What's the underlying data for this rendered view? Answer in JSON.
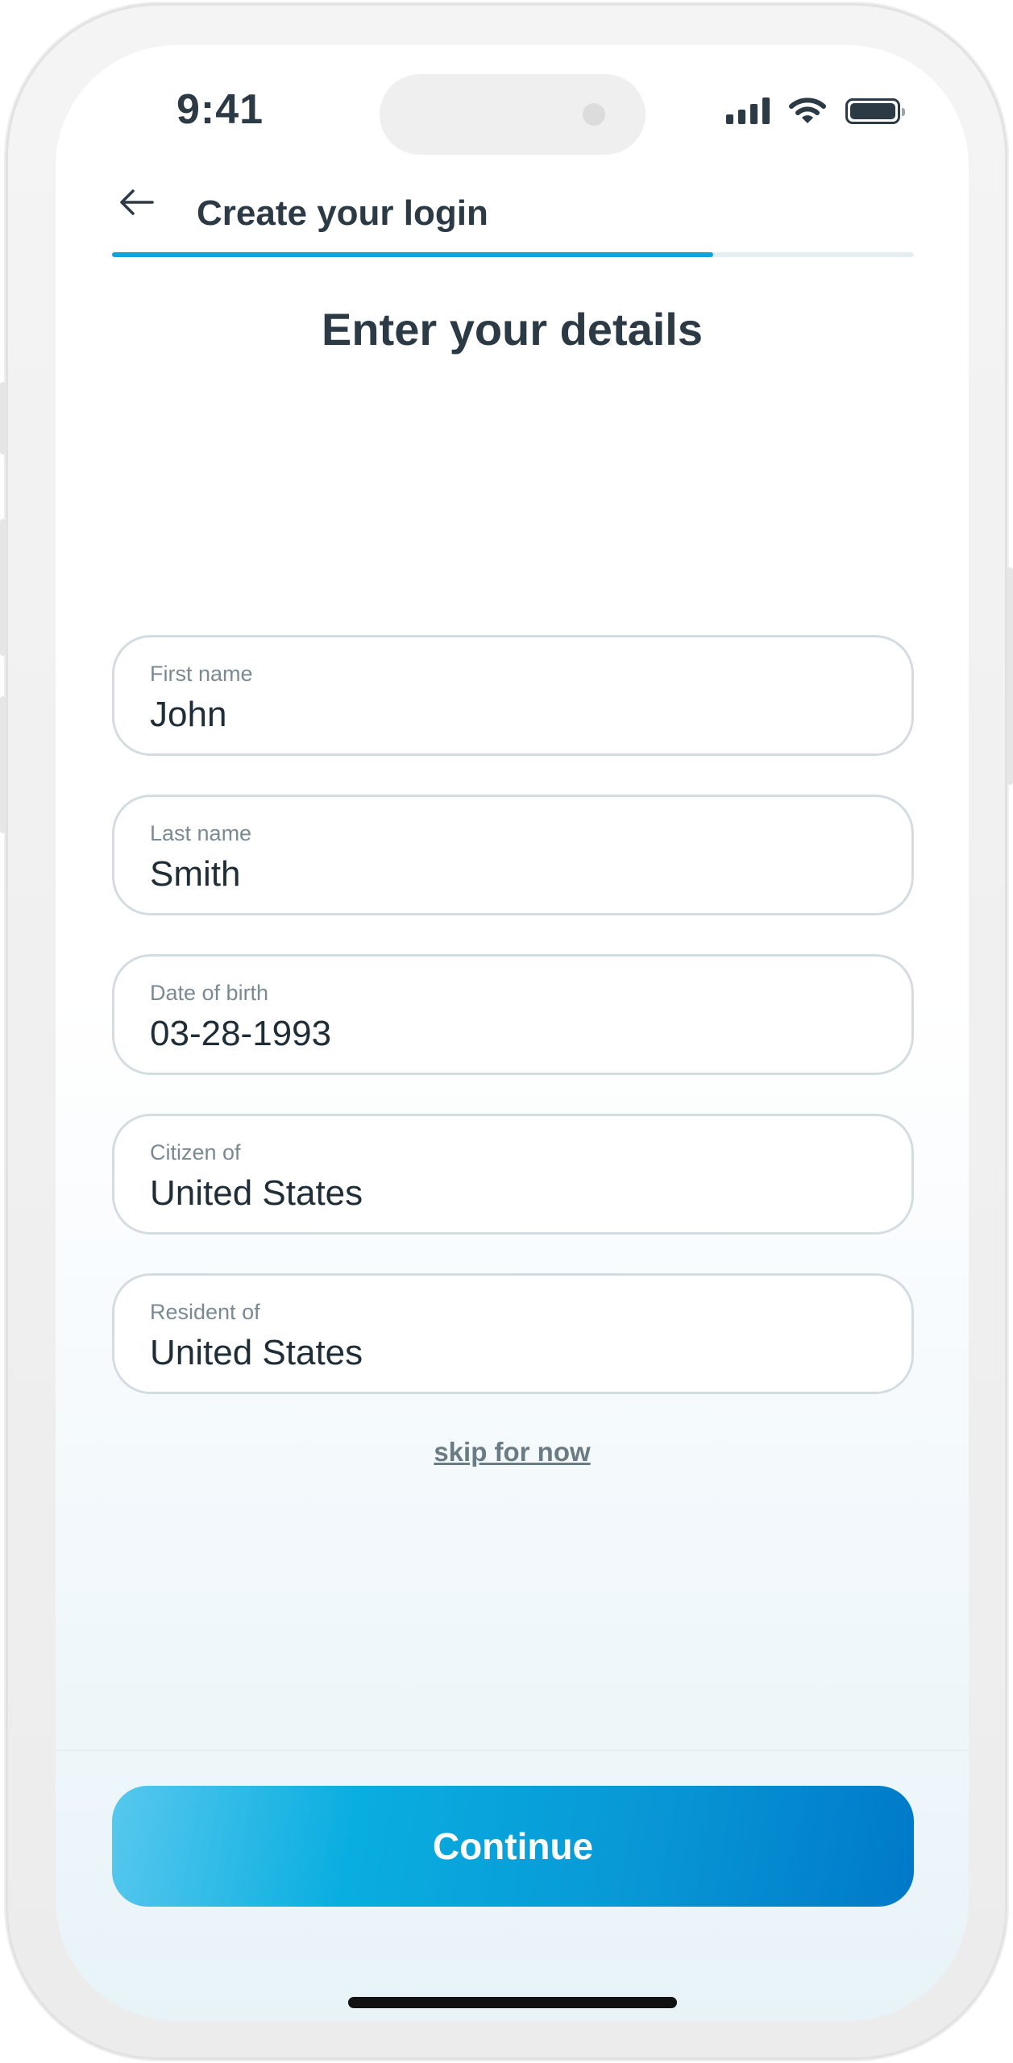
{
  "status_bar": {
    "time": "9:41",
    "icons": [
      "signal-icon",
      "wifi-icon",
      "battery-icon"
    ]
  },
  "header": {
    "back_icon": "arrow-left-icon",
    "title": "Create your login",
    "progress": 0.75
  },
  "page": {
    "heading": "Enter your details"
  },
  "form": {
    "fields": [
      {
        "label": "First name",
        "value": "John"
      },
      {
        "label": "Last name",
        "value": "Smith"
      },
      {
        "label": "Date of birth",
        "value": "03-28-1993"
      },
      {
        "label": "Citizen of",
        "value": "United States"
      },
      {
        "label": "Resident of",
        "value": "United States"
      }
    ]
  },
  "actions": {
    "skip_label": "skip for now",
    "continue_label": "Continue"
  },
  "colors": {
    "accent": "#11a4d9",
    "text": "#2b3a44",
    "button_start": "#57c8ee",
    "button_end": "#0079c8"
  }
}
